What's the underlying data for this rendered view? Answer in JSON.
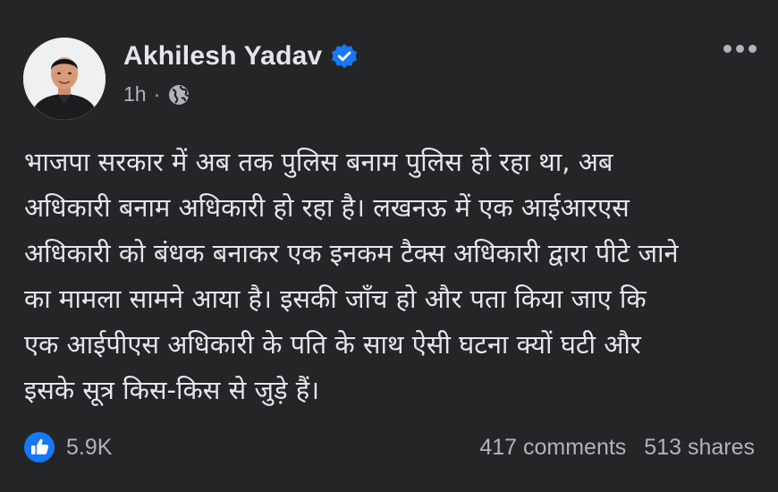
{
  "post": {
    "author": "Akhilesh Yadav",
    "time": "1h",
    "separator": "·",
    "privacy_icon": "globe-icon",
    "verified_icon": "verified-badge-icon",
    "lines": [
      "भाजपा सरकार में अब तक पुलिस बनाम पुलिस हो रहा था, अब",
      "अधिकारी बनाम अधिकारी हो रहा है। लखनऊ में एक आईआरएस",
      "अधिकारी को बंधक बनाकर एक इनकम टैक्स अधिकारी द्वारा पीटे जाने",
      "का मामला सामने आया है। इसकी जाँच हो और पता किया जाए कि",
      "एक आईपीएस अधिकारी के पति के साथ ऐसी घटना क्यों घटी और",
      "इसके सूत्र किस-किस से जुड़े हैं।"
    ]
  },
  "footer": {
    "reactions_count": "5.9K",
    "comments": "417 comments",
    "shares": "513 shares"
  },
  "colors": {
    "background": "#242526",
    "text_primary": "#e4e6eb",
    "text_secondary": "#b0b3b8",
    "accent_blue": "#1877f2"
  }
}
